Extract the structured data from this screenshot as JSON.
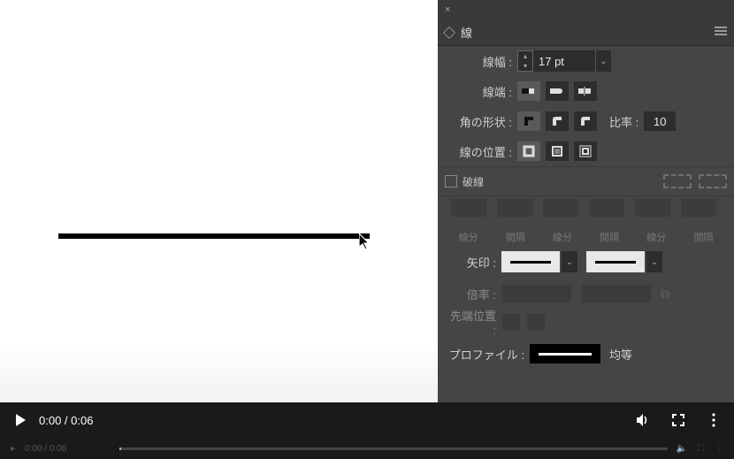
{
  "panel": {
    "close_glyph": "×",
    "tab_label": "線",
    "weight_label": "線幅 :",
    "weight_value": "17 pt",
    "cap_label": "線端 :",
    "corner_label": "角の形状 :",
    "ratio_label": "比率 :",
    "ratio_value": "10",
    "align_label": "線の位置 :",
    "dashed_label": "破線",
    "dash_headers": [
      "線分",
      "間隔",
      "線分",
      "間隔",
      "線分",
      "間隔"
    ],
    "arrow_label": "矢印 :",
    "scale_label": "倍率 :",
    "tip_pos_label": "先端位置 :",
    "profile_label": "プロファイル :",
    "profile_value": "均等"
  },
  "video": {
    "current_time": "0:00",
    "duration": "0:06",
    "ghost_time": "0:00 / 0:06"
  }
}
